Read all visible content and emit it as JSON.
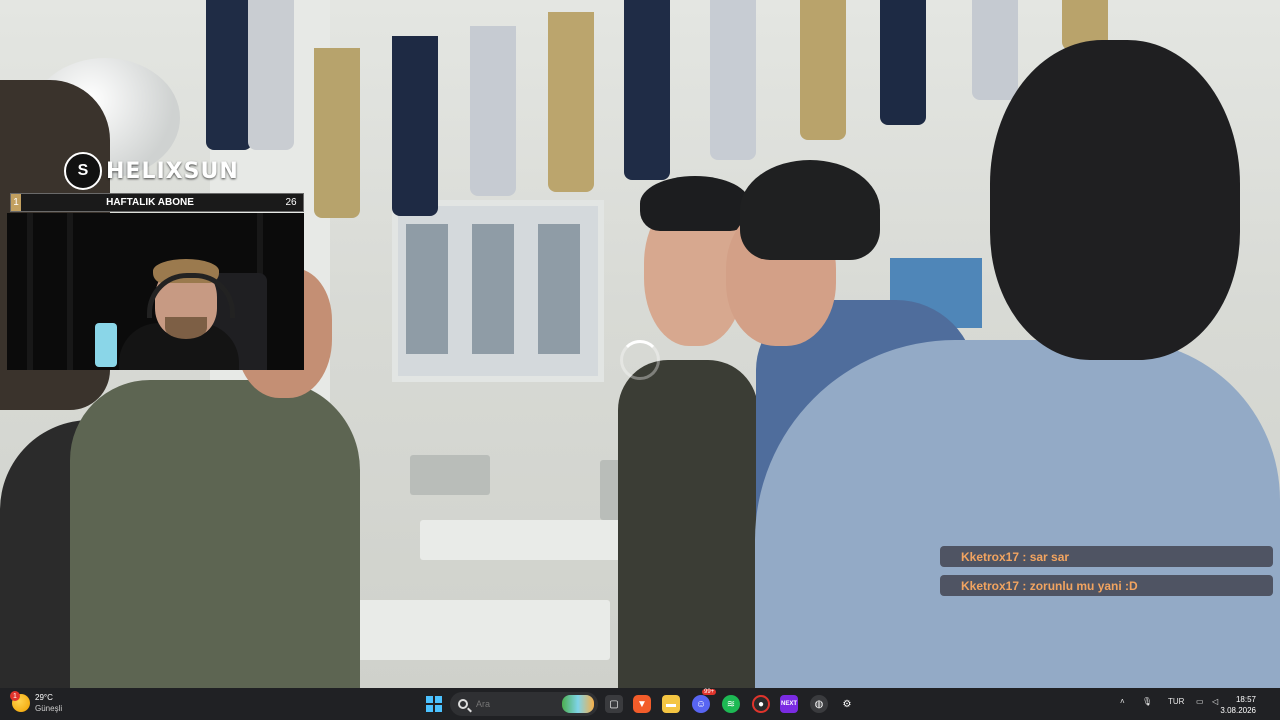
{
  "overlay": {
    "logo_text": "HELIXSUN",
    "weekly_sub": {
      "rank": "1",
      "label": "HAFTALIK ABONE",
      "count": "26"
    },
    "loading": true
  },
  "chat": [
    {
      "user": "Kketrox17",
      "message": "sar sar"
    },
    {
      "user": "Kketrox17",
      "message": "zorunlu mu yani :D"
    }
  ],
  "taskbar": {
    "weather": {
      "temp": "29°C",
      "condition": "Güneşli",
      "badge": "1"
    },
    "search": {
      "placeholder": "Ara"
    },
    "apps": [
      "windows-start",
      "search",
      "task-view",
      "brave",
      "file-explorer",
      "discord",
      "spotify",
      "obs",
      "next",
      "chrome-alt",
      "settings"
    ],
    "discord_badge": "99+",
    "tray": {
      "language": "TUR"
    },
    "clock": {
      "time": "18:57",
      "date": "3.08.2026"
    }
  },
  "colors": {
    "chat_text": "#f2a460",
    "taskbar_bg": "#202124",
    "accent_gold": "#c2a060"
  }
}
